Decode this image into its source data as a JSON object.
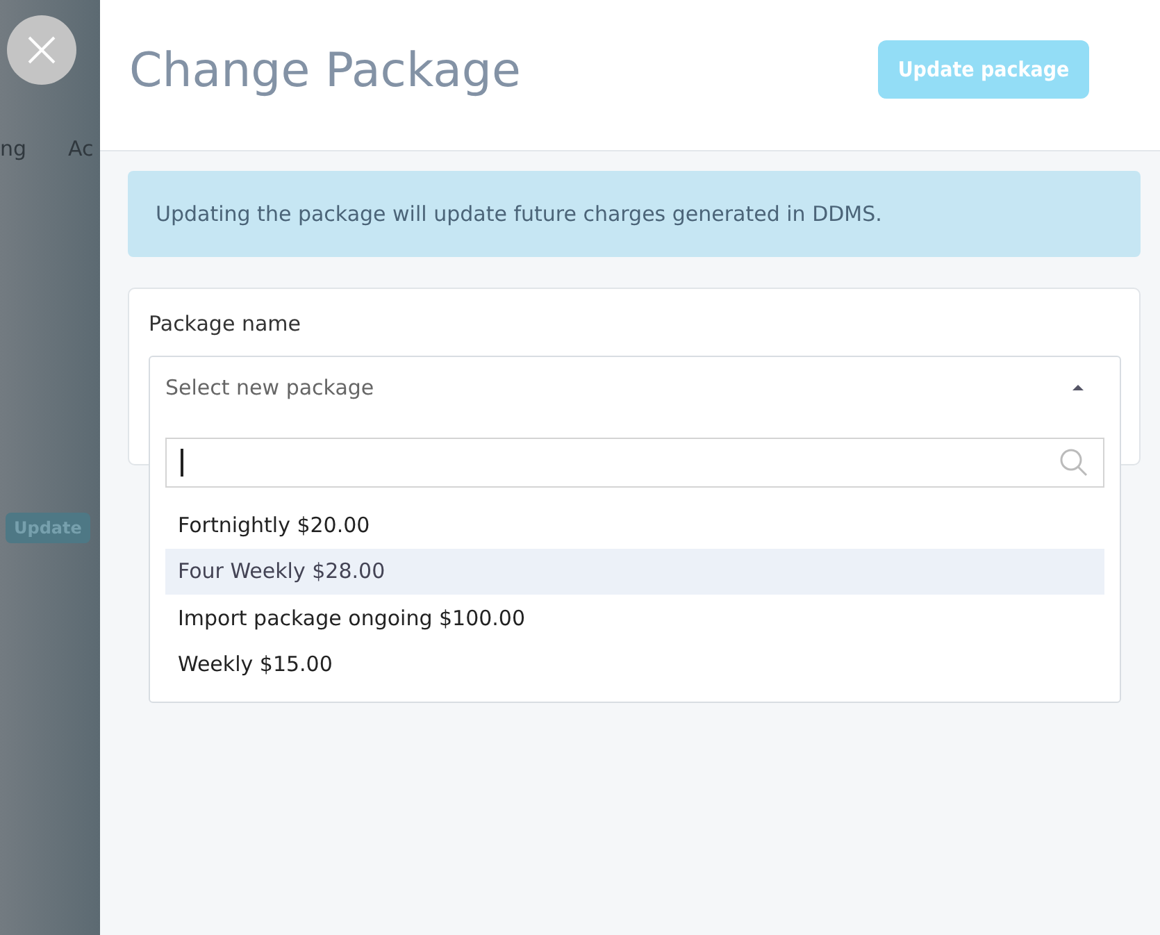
{
  "background": {
    "tabs": [
      "ng",
      "Ac"
    ],
    "button": "Update"
  },
  "header": {
    "title": "Change Package",
    "button": "Update package",
    "button_disabled": true
  },
  "info": "Updating the package will update future charges generated in DDMS.",
  "form": {
    "label": "Package name",
    "select": {
      "placeholder": "Select new package",
      "expanded": true,
      "options": [
        {
          "label": "Fortnightly $20.00",
          "selected": false
        },
        {
          "label": "Four Weekly $28.00",
          "selected": true
        },
        {
          "label": "Import package ongoing $100.00",
          "selected": false
        },
        {
          "label": "Weekly $15.00",
          "selected": false
        }
      ]
    }
  }
}
